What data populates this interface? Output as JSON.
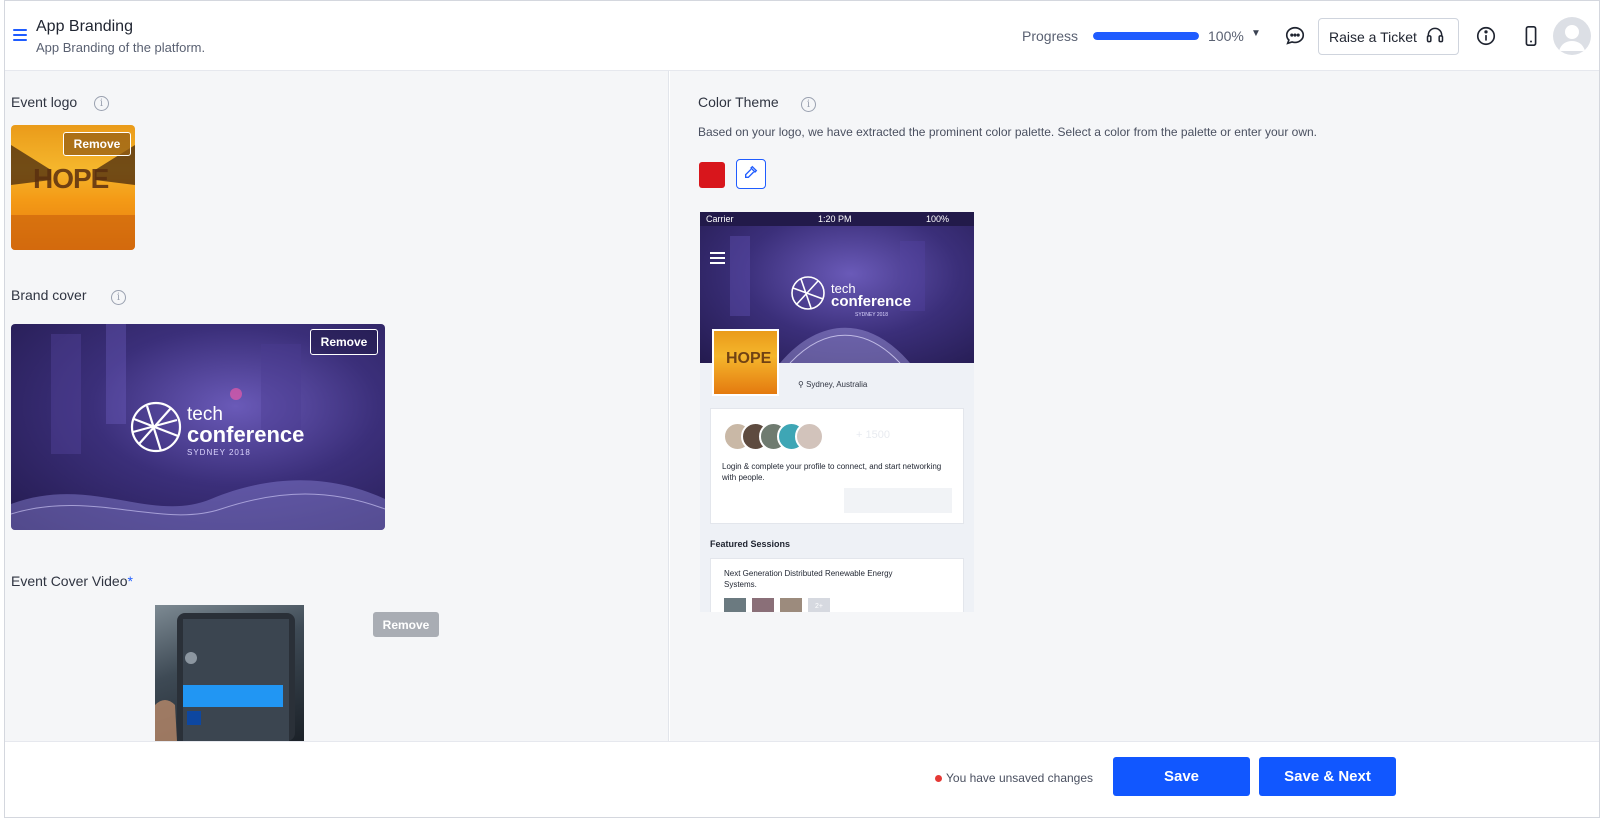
{
  "header": {
    "title": "App Branding",
    "subtitle": "App Branding of the platform.",
    "progress_label": "Progress",
    "progress_value": "100%",
    "progress_fraction": 1.0,
    "raise_ticket_label": "Raise a Ticket",
    "icons": [
      "menu-icon",
      "chat-icon",
      "headset-icon",
      "info-icon",
      "mobile-icon",
      "user-avatar-icon"
    ]
  },
  "left": {
    "event_logo_label": "Event logo",
    "event_logo_remove": "Remove",
    "event_logo_image_text": "HOPE",
    "brand_cover_label": "Brand cover",
    "brand_cover_remove": "Remove",
    "cover_tech": "tech",
    "cover_conference": "conference",
    "cover_sub": "SYDNEY 2018",
    "event_cover_video_label": "Event Cover Video",
    "required_mark": "*",
    "video_remove": "Remove"
  },
  "right": {
    "color_theme_label": "Color Theme",
    "color_theme_description": "Based on your logo, we have extracted the prominent color palette. Select a color from the palette or enter your own.",
    "palette": [
      "#d8161c"
    ],
    "preview": {
      "carrier": "Carrier",
      "time": "1:20 PM",
      "battery": "100%",
      "tech": "tech",
      "conference": "conference",
      "sub": "SYDNEY 2018",
      "logo_text": "HOPE",
      "location": "Sydney, Australia",
      "attendee_count": "+ 1500",
      "login_text": "Login & complete your profile to connect, and start networking with people.",
      "featured_sessions": "Featured Sessions",
      "session_title": "Next Generation Distributed Renewable Energy Systems.",
      "session_more": "2+"
    }
  },
  "footer": {
    "unsaved_text": "You have unsaved changes",
    "save_label": "Save",
    "save_next_label": "Save & Next"
  },
  "colors": {
    "primary": "#1157ff",
    "accent_red": "#d8161c",
    "unsaved_dot": "#e53935"
  }
}
